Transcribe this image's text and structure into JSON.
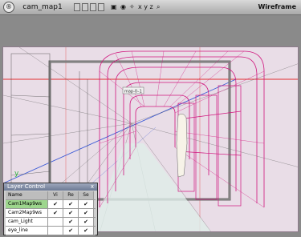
{
  "topbar": {
    "menu_button": "®",
    "title": "cam_map1",
    "axes": "x y z",
    "render_mode": "Wireframe"
  },
  "viewport": {
    "axis_label": "y",
    "camera_tag": "map-0–1"
  },
  "layer_panel": {
    "title": "Layer Control",
    "close": "x",
    "columns": [
      "Name",
      "Vi",
      "Re",
      "Se"
    ],
    "rows": [
      {
        "name": "Cam1Map9ws",
        "vi": "✔",
        "re": "✔",
        "se": "✔",
        "active": true
      },
      {
        "name": "Cam2Map9ws",
        "vi": "✔",
        "re": "✔",
        "se": "✔",
        "active": false
      },
      {
        "name": "cam_Light",
        "vi": "",
        "re": "✔",
        "se": "✔",
        "active": false
      },
      {
        "name": "eye_line",
        "vi": "",
        "re": "✔",
        "se": "✔",
        "active": false
      }
    ]
  },
  "colors": {
    "wireframe": "#d0157d",
    "guide_red": "#e33030",
    "guide_blue": "#3d5bd6",
    "active_layer": "#9dd68d"
  }
}
